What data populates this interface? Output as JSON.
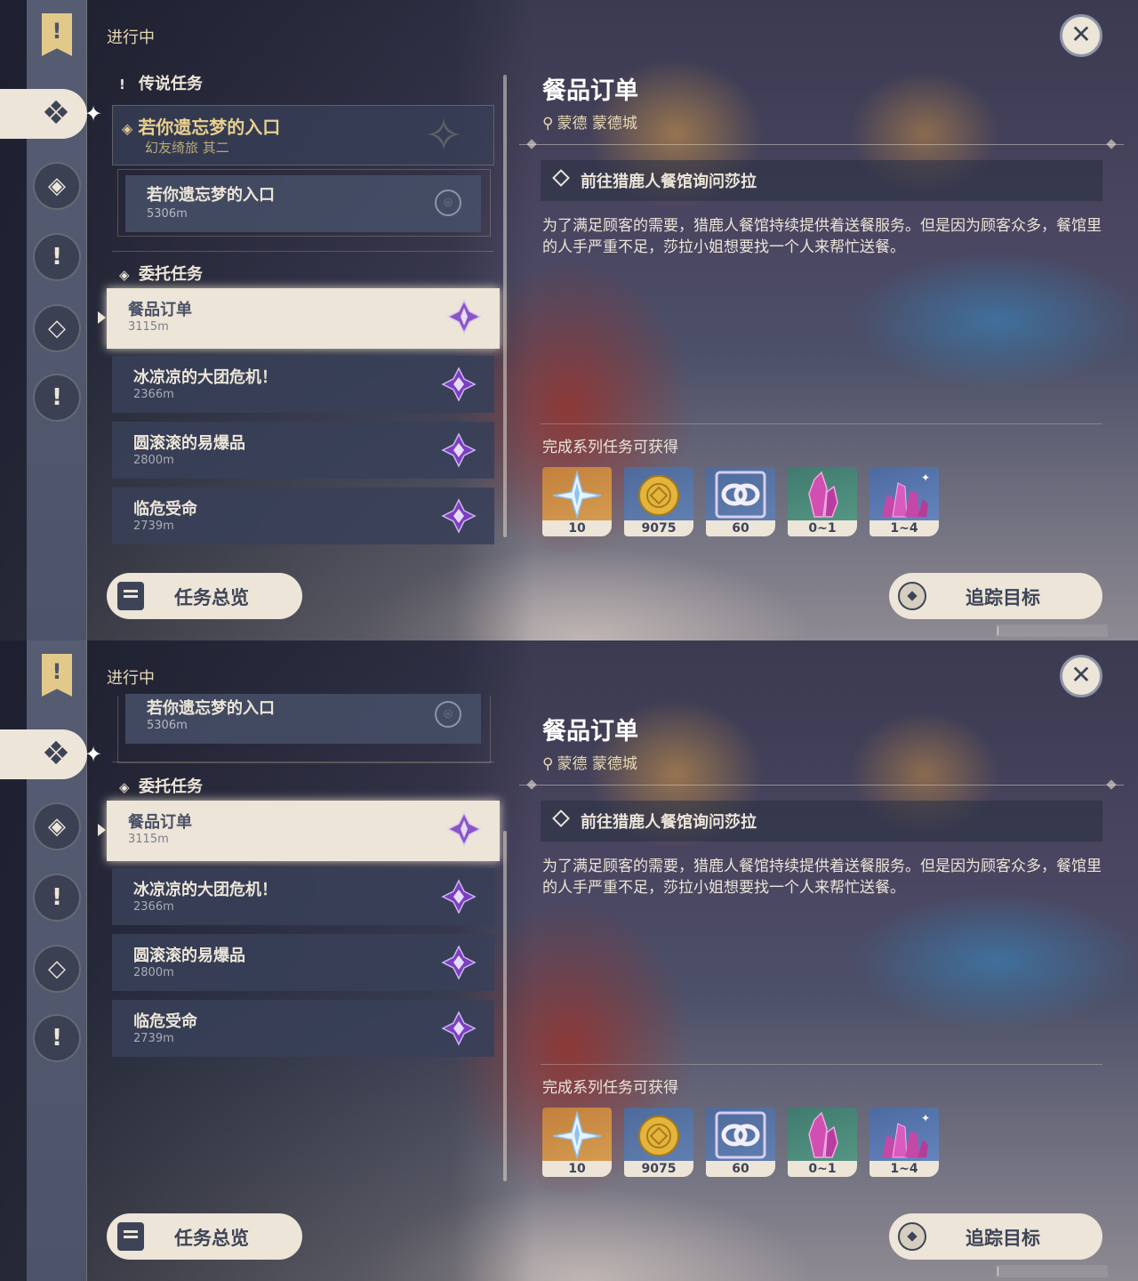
{
  "status_label": "进行中",
  "close_symbol": "✕",
  "sidebar": {
    "bookmark_glyph": "!",
    "items": [
      {
        "icon": "archon-quest-icon",
        "active": true
      },
      {
        "icon": "story-quest-icon"
      },
      {
        "icon": "world-quest-icon"
      },
      {
        "icon": "commission-quest-icon"
      },
      {
        "icon": "event-quest-icon"
      }
    ]
  },
  "quest_list": {
    "legend_header": "传说任务",
    "legend_quest": {
      "title": "若你遗忘梦的入口",
      "subtitle": "幻友绮旅 其二"
    },
    "legend_step": {
      "title": "若你遗忘梦的入口",
      "distance": "5306m"
    },
    "commission_header": "委托任务",
    "commissions": [
      {
        "title": "餐品订单",
        "distance": "3115m",
        "selected": true
      },
      {
        "title": "冰凉凉的大团危机！",
        "distance": "2366m"
      },
      {
        "title": "圆滚滚的易爆品",
        "distance": "2800m"
      },
      {
        "title": "临危受命",
        "distance": "2739m"
      }
    ]
  },
  "detail": {
    "title": "餐品订单",
    "location": "蒙德 蒙德城",
    "objective": "前往猎鹿人餐馆询问莎拉",
    "description": "为了满足顾客的需要，猎鹿人餐馆持续提供着送餐服务。但是因为顾客众多，餐馆里的人手严重不足，莎拉小姐想要找一个人来帮忙送餐。",
    "reward_label": "完成系列任务可获得",
    "rewards": [
      {
        "icon": "primogem-icon",
        "count": "10"
      },
      {
        "icon": "mora-icon",
        "count": "9075"
      },
      {
        "icon": "adventure-exp-icon",
        "count": "60"
      },
      {
        "icon": "crystal-chunk-icon",
        "count": "0~1"
      },
      {
        "icon": "crystal-cluster-icon",
        "count": "1~4"
      }
    ]
  },
  "buttons": {
    "overview": "任务总览",
    "track": "追踪目标"
  },
  "colors": {
    "cream": "#ece5d8",
    "gold": "#e8cf8e",
    "slate": "#3e4457",
    "purple": "#7b3fc0"
  }
}
